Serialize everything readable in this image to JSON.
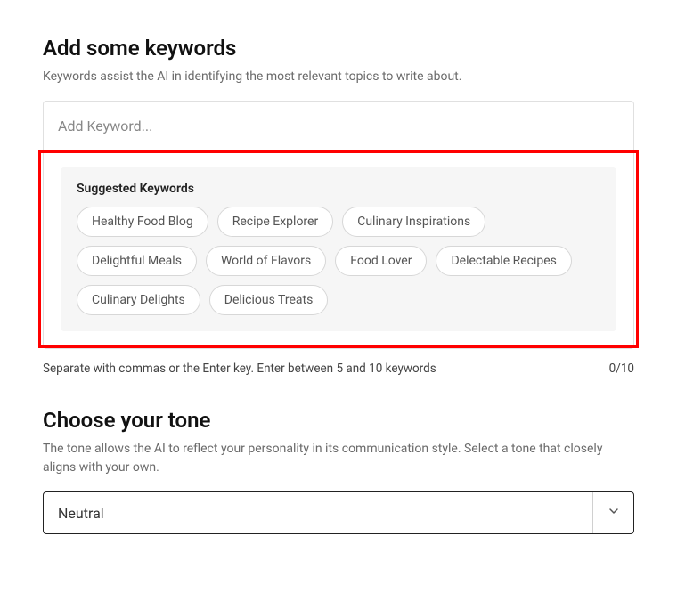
{
  "keywords_section": {
    "title": "Add some keywords",
    "subtext": "Keywords assist the AI in identifying the most relevant topics to write about.",
    "input_placeholder": "Add Keyword...",
    "suggested_title": "Suggested Keywords",
    "suggestions": [
      "Healthy Food Blog",
      "Recipe Explorer",
      "Culinary Inspirations",
      "Delightful Meals",
      "World of Flavors",
      "Food Lover",
      "Delectable Recipes",
      "Culinary Delights",
      "Delicious Treats"
    ],
    "helper_text": "Separate with commas or the Enter key. Enter between 5 and 10 keywords",
    "count_text": "0/10"
  },
  "tone_section": {
    "title": "Choose your tone",
    "subtext": "The tone allows the AI to reflect your personality in its communication style. Select a tone that closely aligns with your own.",
    "selected": "Neutral"
  }
}
